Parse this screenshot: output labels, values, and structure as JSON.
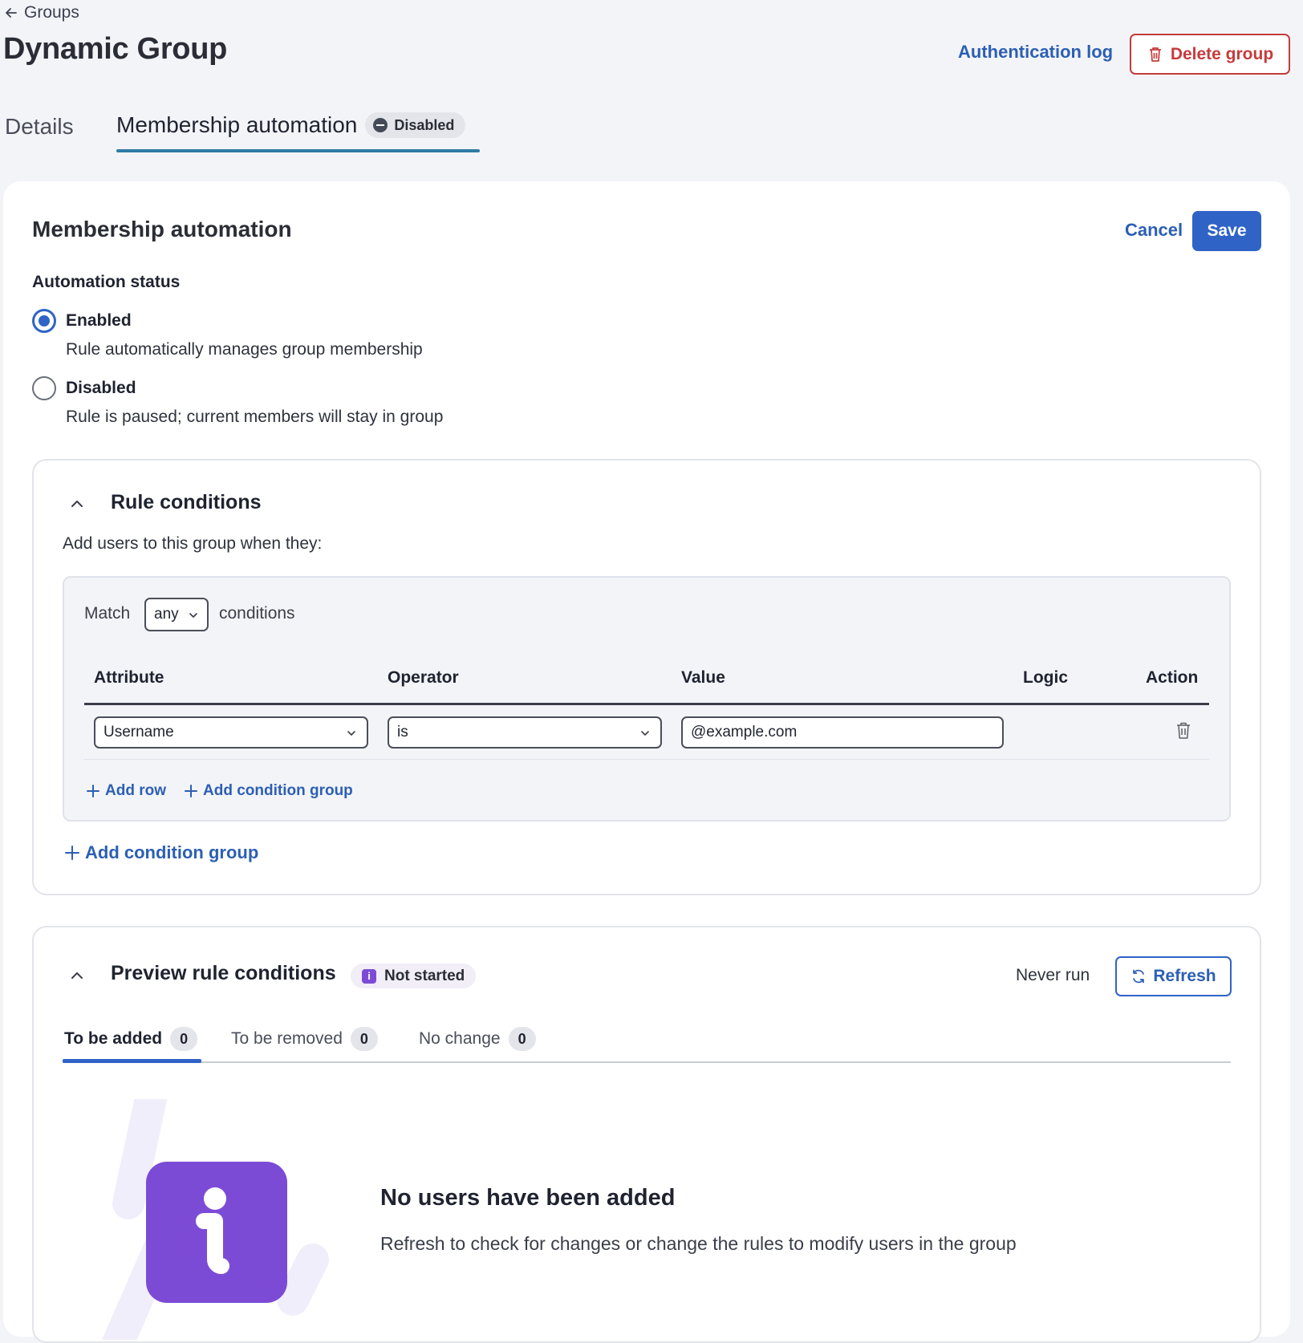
{
  "header": {
    "back_label": "Groups",
    "title": "Dynamic Group",
    "auth_log_label": "Authentication log",
    "delete_label": "Delete group"
  },
  "tabs": {
    "details": "Details",
    "automation": "Membership automation",
    "automation_badge": "Disabled"
  },
  "card": {
    "title": "Membership automation",
    "cancel_label": "Cancel",
    "save_label": "Save",
    "status_label": "Automation status",
    "options": [
      {
        "title": "Enabled",
        "desc": "Rule automatically manages group membership",
        "selected": true
      },
      {
        "title": "Disabled",
        "desc": "Rule is paused; current members will stay in group",
        "selected": false
      }
    ]
  },
  "rules": {
    "title": "Rule conditions",
    "subtitle": "Add users to this group when they:",
    "match_prefix": "Match",
    "match_value": "any",
    "match_suffix": "conditions",
    "headers": {
      "attribute": "Attribute",
      "operator": "Operator",
      "value": "Value",
      "logic": "Logic",
      "action": "Action"
    },
    "row": {
      "attribute": "Username",
      "operator": "is",
      "value": "@example.com"
    },
    "add_row_label": "Add row",
    "add_condition_group_inner": "Add condition group",
    "add_condition_group_outer": "Add condition group"
  },
  "preview": {
    "title": "Preview rule conditions",
    "badge": "Not started",
    "badge_icon": "i",
    "last_run": "Never run",
    "refresh_label": "Refresh",
    "tabs": [
      {
        "label": "To be added",
        "count": "0"
      },
      {
        "label": "To be removed",
        "count": "0"
      },
      {
        "label": "No change",
        "count": "0"
      }
    ],
    "empty_title": "No users have been added",
    "empty_desc": "Refresh to check for changes or change the rules to modify users in the group"
  },
  "colors": {
    "accent": "#2f63c6",
    "danger": "#c63b3b",
    "info_purple": "#7c4bd6",
    "tab_underline": "#2f7aa6"
  }
}
